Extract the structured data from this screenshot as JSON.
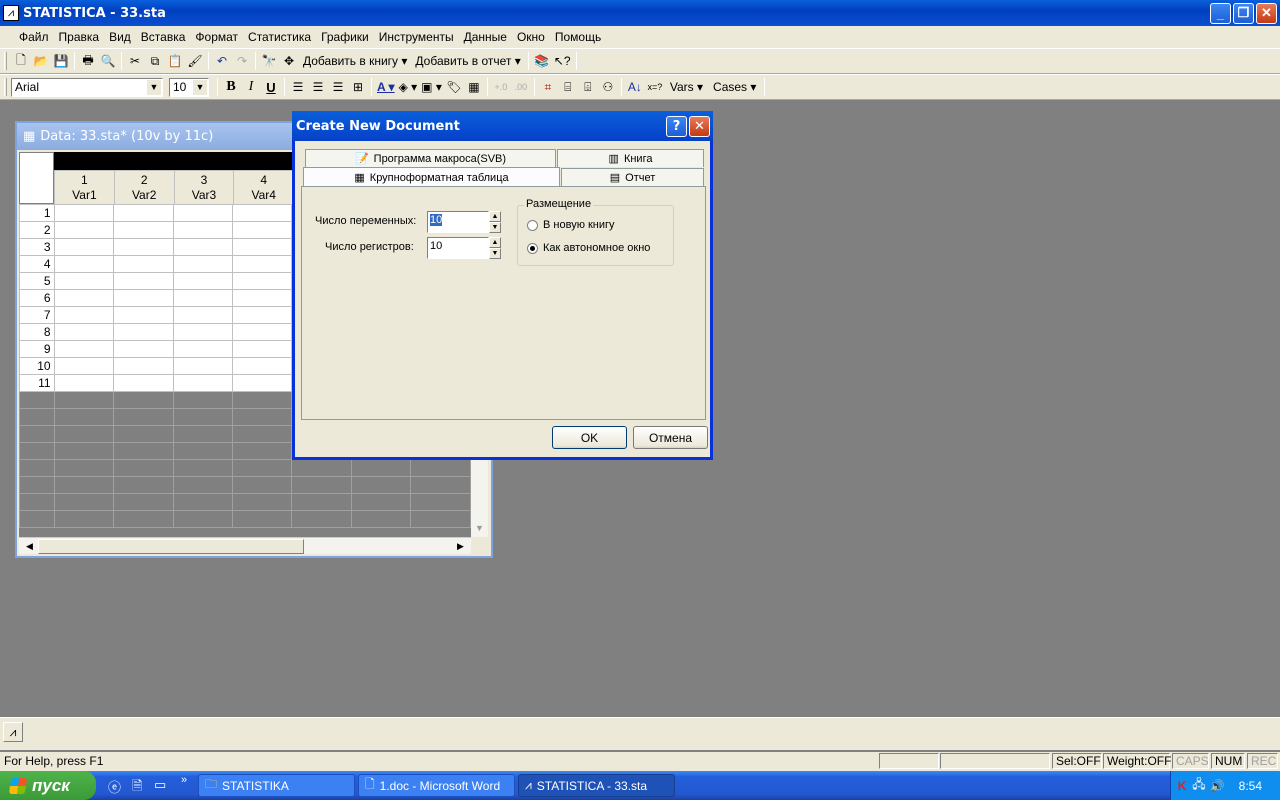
{
  "app": {
    "title": "STATISTICA - 33.sta",
    "icon": "statistica-icon"
  },
  "menu": [
    "Файл",
    "Правка",
    "Вид",
    "Вставка",
    "Формат",
    "Статистика",
    "Графики",
    "Инструменты",
    "Данные",
    "Окно",
    "Помощь"
  ],
  "toolbar1": {
    "add_to_book": "Добавить в книгу",
    "add_to_report": "Добавить в отчет"
  },
  "toolbar2": {
    "font_name": "Arial",
    "font_size": "10",
    "bold": "B",
    "italic": "I",
    "underline": "U",
    "vars": "Vars",
    "cases": "Cases"
  },
  "data_window": {
    "title": "Data: 33.sta* (10v by 11c)",
    "columns": [
      {
        "num": "1",
        "name": "Var1"
      },
      {
        "num": "2",
        "name": "Var2"
      },
      {
        "num": "3",
        "name": "Var3"
      },
      {
        "num": "4",
        "name": "Var4"
      }
    ],
    "rows": [
      "1",
      "2",
      "3",
      "4",
      "5",
      "6",
      "7",
      "8",
      "9",
      "10",
      "11"
    ]
  },
  "dialog": {
    "title": "Create New Document",
    "tabs": {
      "macro": "Программа макроса(SVB)",
      "book": "Книга",
      "spreadsheet": "Крупноформатная таблица",
      "report": "Отчет"
    },
    "num_vars_label": "Число переменных:",
    "num_vars_value": "10",
    "num_cases_label": "Число регистров:",
    "num_cases_value": "10",
    "placement_title": "Размещение",
    "placement_options": [
      "В новую книгу",
      "Как автономное окно"
    ],
    "placement_selected": "Как автономное окно",
    "ok": "OK",
    "cancel": "Отмена"
  },
  "statusbar": {
    "help": "For Help, press F1",
    "sel": "Sel:OFF",
    "weight": "Weight:OFF",
    "caps": "CAPS",
    "num": "NUM",
    "rec": "REC"
  },
  "taskbar": {
    "start": "пуск",
    "tasks": [
      "STATISTIKA",
      "1.doc - Microsoft Word",
      "STATISTICA - 33.sta"
    ],
    "clock": "8:54"
  }
}
